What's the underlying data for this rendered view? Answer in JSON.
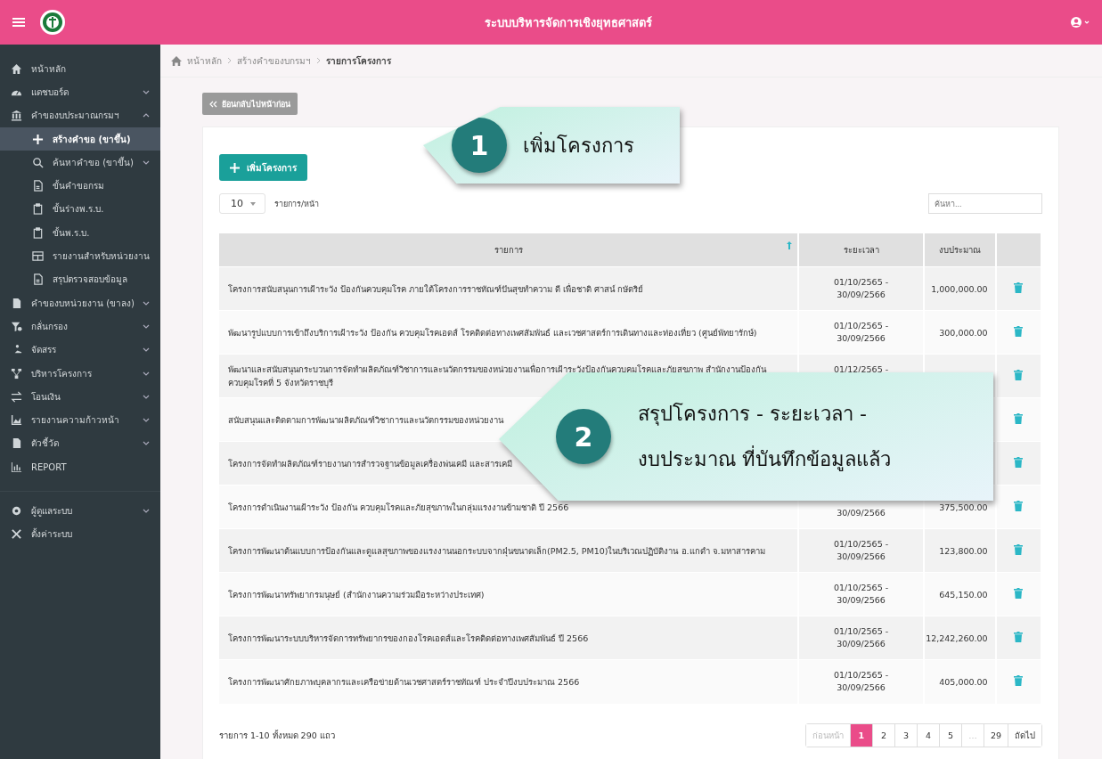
{
  "header": {
    "title": "ระบบบริหารจัดการเชิงยุทธศาสตร์"
  },
  "sidebar": {
    "sections": [
      {
        "items": [
          {
            "label": "หน้าหลัก",
            "kind": "link",
            "selected": false
          },
          {
            "label": "แดชบอร์ด",
            "kind": "group",
            "selected": false,
            "expanded": false
          },
          {
            "label": "คำของบประมาณกรมฯ",
            "kind": "group",
            "selected": false,
            "expanded": true,
            "children": [
              {
                "label": "สร้างคำขอ (ขาขึ้น)",
                "kind": "link",
                "selected": true
              },
              {
                "label": "ค้นหาคำขอ (ขาขึ้น)",
                "kind": "group",
                "selected": false,
                "expanded": false
              },
              {
                "label": "ขั้นคำขอกรม",
                "kind": "link",
                "selected": false
              },
              {
                "label": "ขั้นร่างพ.ร.บ.",
                "kind": "link",
                "selected": false
              },
              {
                "label": "ขั้นพ.ร.บ.",
                "kind": "link",
                "selected": false
              },
              {
                "label": "รายงานสำหรับหน่วยงาน",
                "kind": "link",
                "selected": false
              },
              {
                "label": "สรุปตรวจสอบข้อมูล",
                "kind": "link",
                "selected": false
              }
            ]
          },
          {
            "label": "คำของบหน่วยงาน (ขาลง)",
            "kind": "group",
            "selected": false,
            "expanded": false
          },
          {
            "label": "กลั่นกรอง",
            "kind": "group",
            "selected": false,
            "expanded": false
          },
          {
            "label": "จัดสรร",
            "kind": "group",
            "selected": false,
            "expanded": false
          },
          {
            "label": "บริหารโครงการ",
            "kind": "group",
            "selected": false,
            "expanded": false
          },
          {
            "label": "โอนเงิน",
            "kind": "group",
            "selected": false,
            "expanded": false
          },
          {
            "label": "รายงานความก้าวหน้า",
            "kind": "group",
            "selected": false,
            "expanded": false
          },
          {
            "label": "ตัวชี้วัด",
            "kind": "group",
            "selected": false,
            "expanded": false
          },
          {
            "label": "REPORT",
            "kind": "link",
            "selected": false
          }
        ]
      },
      {
        "items": [
          {
            "label": "ผู้ดูแลระบบ",
            "kind": "group",
            "selected": false,
            "expanded": false
          },
          {
            "label": "ตั้งค่าระบบ",
            "kind": "link",
            "selected": false
          }
        ]
      }
    ]
  },
  "breadcrumb": [
    "หน้าหลัก",
    "สร้างคำของบกรมฯ",
    "รายการโครงการ"
  ],
  "back_button": "ย้อนกลับไปหน้าก่อน",
  "add_button": "เพิ่มโครงการ",
  "page_size": {
    "value": "10",
    "label": "รายการ/หน้า"
  },
  "search": {
    "placeholder": "ค้นหา..."
  },
  "table": {
    "columns": [
      {
        "label": "รายการ",
        "sorted": true
      },
      {
        "label": "ระยะเวลา",
        "sorted": false
      },
      {
        "label": "งบประมาณ",
        "sorted": false
      }
    ],
    "rows": [
      {
        "name": "โครงการสนับสนุนการเฝ้าระวัง ป้องกันควบคุมโรค ภายใต้โครงการราชทัณฑ์ปันสุขทำความ ดี เพื่อชาติ ศาสน์ กษัตริย์",
        "period": {
          "start": "01/10/2565 -",
          "end": "30/09/2566"
        },
        "budget": "1,000,000.00"
      },
      {
        "name": "พัฒนารูปแบบการเข้าถึงบริการเฝ้าระวัง ป้องกัน ควบคุมโรคเอดส์ โรคติดต่อทางเพศสัมพันธ์ และเวชศาสตร์การเดินทางและท่องเที่ยว (ศูนย์พัทยารักษ์)",
        "period": {
          "start": "01/10/2565 -",
          "end": "30/09/2566"
        },
        "budget": "300,000.00"
      },
      {
        "name": "พัฒนาและสนับสนุนกระบวนการจัดทำผลิตภัณฑ์วิชาการและนวัตกรรมของหน่วยงานเพื่อการเฝ้าระวังป้องกันควบคุมโรคและภัยสุขภาพ สำนักงานป้องกันควบคุมโรคที่ 5 จังหวัดราชบุรี",
        "period": {
          "start": "01/12/2565 -"
        }
      },
      {
        "name": "สนับสนุนและติดตามการพัฒนาผลิตภัณฑ์วิชาการและนวัตกรรมของหน่วยงาน",
        "period": {}
      },
      {
        "name": "โครงการจัดทำผลิตภัณฑ์รายงานการสำรวจฐานข้อมูลเครื่องพ่นเคมี และสารเคมี",
        "period": {}
      },
      {
        "name": "โครงการดำเนินงานเฝ้าระวัง ป้องกัน ควบคุมโรคและภัยสุขภาพในกลุ่มแรงงานข้ามชาติ ปี 2566",
        "period": {
          "end": "30/09/2566"
        },
        "budget": "375,500.00"
      },
      {
        "name": "โครงการพัฒนาต้นแบบการป้องกันและดูแลสุขภาพของแรงงานนอกระบบจากฝุ่นขนาดเล็ก(PM2.5, PM10)ในบริเวณปฏิบัติงาน อ.แกดำ จ.มหาสารคาม",
        "period": {
          "start": "01/10/2565 -",
          "end": "30/09/2566"
        },
        "budget": "123,800.00"
      },
      {
        "name": "โครงการพัฒนาทรัพยากรมนุษย์ (สำนักงานความร่วมมือระหว่างประเทศ)",
        "period": {
          "start": "01/10/2565 -",
          "end": "30/09/2566"
        },
        "budget": "645,150.00"
      },
      {
        "name": "โครงการพัฒนาระบบบริหารจัดการทรัพยากรของกองโรคเอดส์และโรคติดต่อทางเพศสัมพันธ์ ปี 2566",
        "period": {
          "start": "01/10/2565 -",
          "end": "30/09/2566"
        },
        "budget": "12,242,260.00"
      },
      {
        "name": "โครงการพัฒนาศักยภาพบุคลากรและเครือข่ายด้านเวชศาสตร์ราชทัณฑ์ ประจำปีงบประมาณ 2566",
        "period": {
          "start": "01/10/2565 -",
          "end": "30/09/2566"
        },
        "budget": "405,000.00"
      }
    ]
  },
  "summary": "รายการ 1-10 ทั้งหมด 290 แถว",
  "pagination": {
    "previous": {
      "label": "ก่อนหน้า",
      "disabled": true
    },
    "pages": [
      {
        "label": "1",
        "kind": "page",
        "selected": true
      },
      {
        "label": "2",
        "kind": "page",
        "selected": false
      },
      {
        "label": "3",
        "kind": "page",
        "selected": false
      },
      {
        "label": "4",
        "kind": "page",
        "selected": false
      },
      {
        "label": "5",
        "kind": "page",
        "selected": false
      },
      {
        "label": "…",
        "kind": "ellipsis"
      },
      {
        "label": "29",
        "kind": "page",
        "selected": false
      }
    ],
    "next": {
      "label": "ถัดไป",
      "disabled": false
    }
  },
  "callouts": [
    {
      "number": "1",
      "lines": [
        "เพิ่มโครงการ"
      ]
    },
    {
      "number": "2",
      "lines": [
        "สรุปโครงการ - ระยะเวลา -",
        "งบประมาณ ที่บันทึกข้อมูลแล้ว"
      ]
    }
  ]
}
